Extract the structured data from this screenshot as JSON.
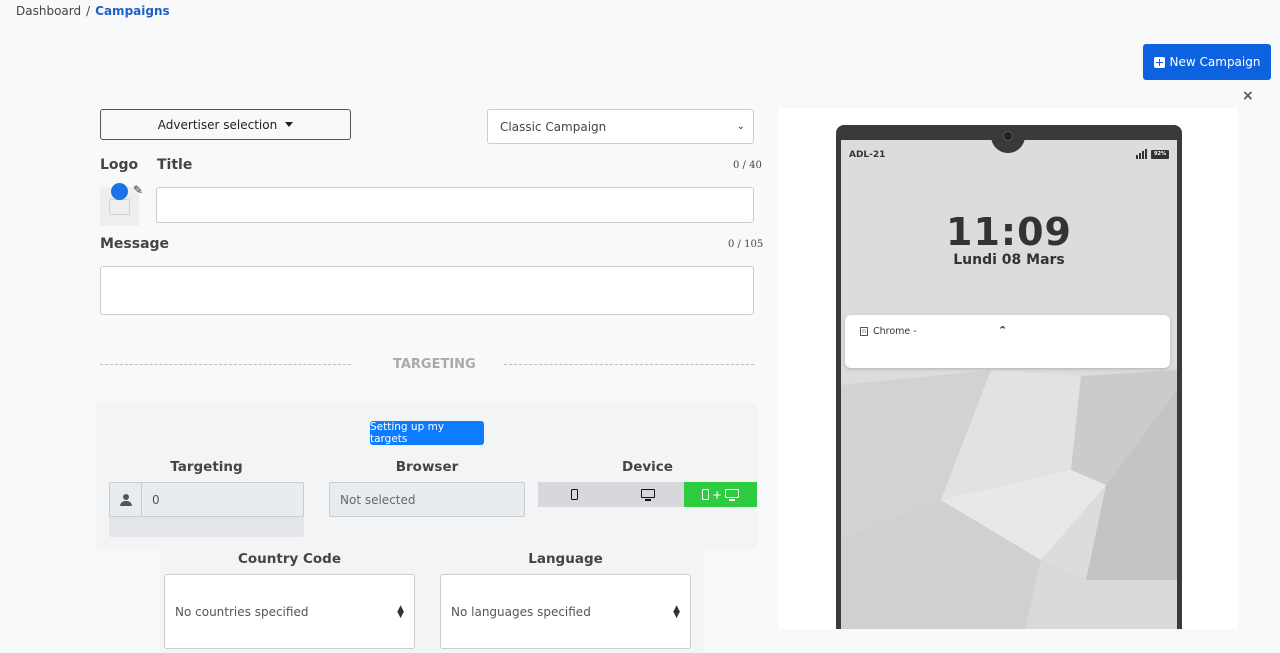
{
  "breadcrumb": {
    "home": "Dashboard",
    "separator": "/",
    "current": "Campaigns"
  },
  "header": {
    "new_campaign_label": "New Campaign",
    "close_label": "×"
  },
  "form": {
    "advertiser_label": "Advertiser selection",
    "campaign_type": "Classic Campaign",
    "logo_label": "Logo",
    "title_label": "Title",
    "title_counter": "0 / 40",
    "title_value": "",
    "message_label": "Message",
    "message_counter": "0 / 105",
    "message_value": ""
  },
  "targeting": {
    "section_title": "TARGETING",
    "setup_button": "Setting up my targets",
    "targeting_label": "Targeting",
    "targeting_value": "0",
    "browser_label": "Browser",
    "browser_value": "Not selected",
    "device_label": "Device",
    "device_plus": "+",
    "device_options": [
      "mobile",
      "desktop",
      "mobile+desktop"
    ],
    "device_selected": "mobile+desktop",
    "country_label": "Country Code",
    "country_value": "No countries specified",
    "language_label": "Language",
    "language_value": "No languages specified"
  },
  "preview": {
    "carrier": "ADL-21",
    "battery": "92%",
    "time": "11:09",
    "date": "Lundi 08 Mars",
    "notification_app": "Chrome -",
    "notification_app_icon": "n"
  },
  "colors": {
    "primary": "#0d62e0",
    "setup_button": "#0d7cff",
    "device_active": "#2ecc40",
    "breadcrumb_active": "#1f5fc8"
  }
}
